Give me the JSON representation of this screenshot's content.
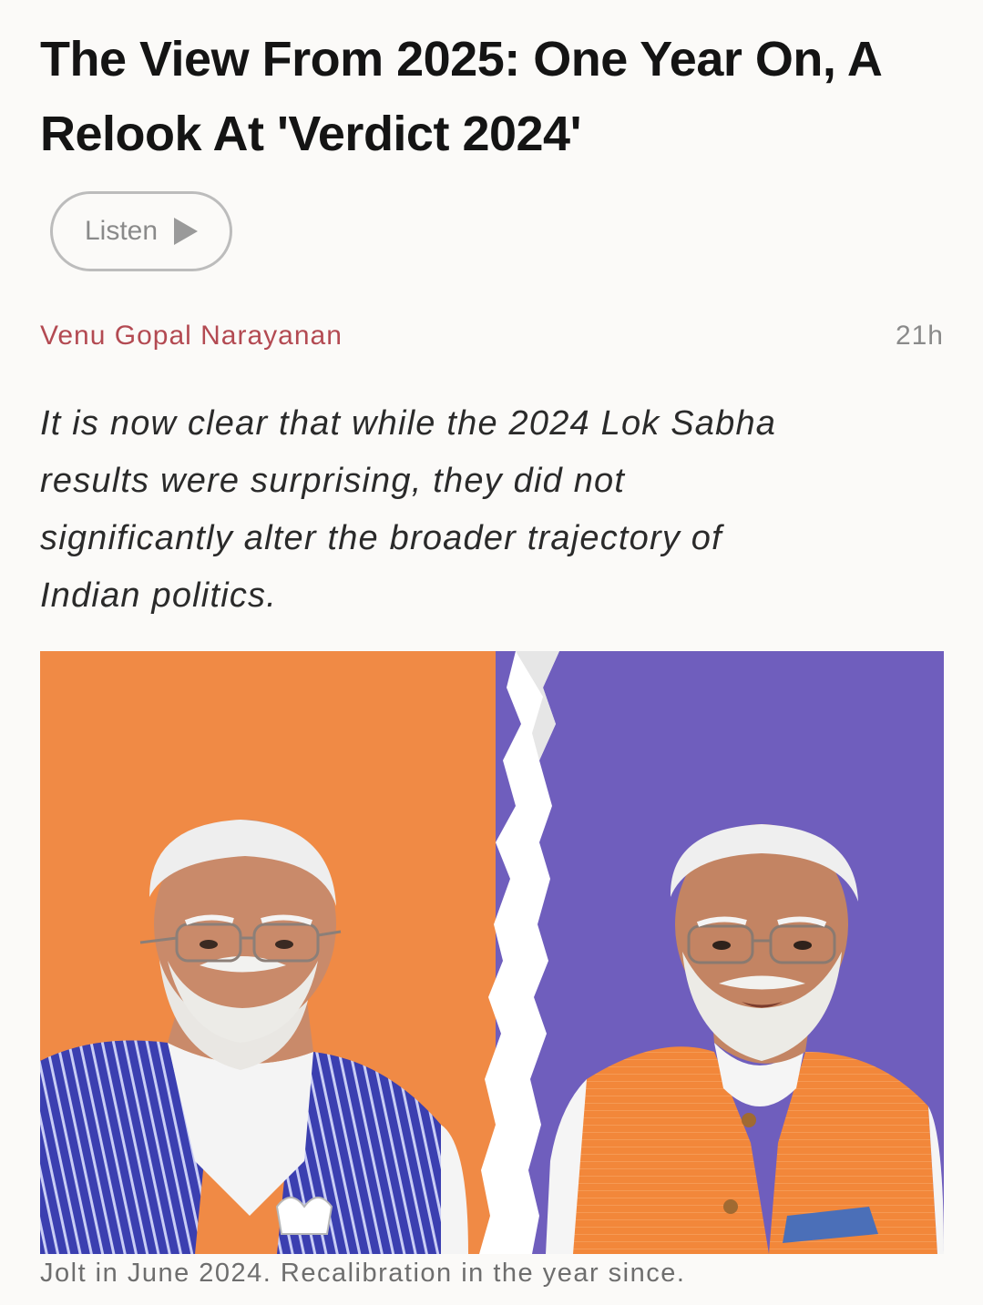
{
  "article": {
    "title_line1": "The View From 2025: One Year On, A",
    "title_line2": "Relook At 'Verdict 2024'",
    "listen_label": "Listen",
    "author": "Venu Gopal Narayanan",
    "time_ago": "21h",
    "standfirst_lines": [
      "It is now clear that while the 2024 Lok Sabha",
      "results were surprising, they did not",
      "significantly alter the broader trajectory of",
      "Indian politics."
    ],
    "caption": "Jolt in June 2024. Recalibration in the year since."
  },
  "colors": {
    "background": "#fbfaf8",
    "title": "#141414",
    "author": "#b34a52",
    "meta": "#8a8a8a",
    "image_left_bg": "#f08a45",
    "image_right_bg": "#6f5ebd",
    "tear": "#ffffff"
  },
  "icons": {
    "listen": "play-icon"
  }
}
